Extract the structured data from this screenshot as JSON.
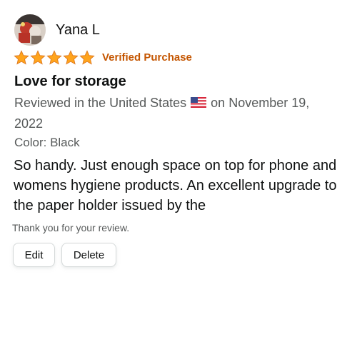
{
  "review": {
    "reviewer_name": "Yana L",
    "avatar_icon": "profile-photo",
    "rating": 5,
    "rating_max": 5,
    "star_color": "#ffa41c",
    "verified_label": "Verified Purchase",
    "verified_color": "#c45500",
    "title": "Love for storage",
    "meta_prefix": "Reviewed in the United States",
    "flag_icon": "us-flag-icon",
    "meta_suffix": "on November 19, 2022",
    "variant": "Color: Black",
    "body": "So handy. Just enough space on top for phone and womens hygiene products. An excellent upgrade to the paper holder issued by the"
  },
  "footer": {
    "thanks_text": "Thank you for your review.",
    "edit_label": "Edit",
    "delete_label": "Delete"
  }
}
